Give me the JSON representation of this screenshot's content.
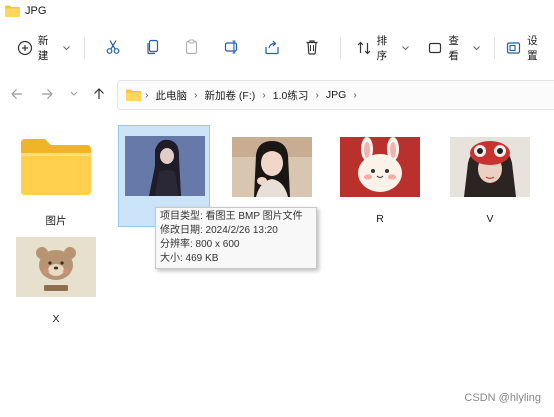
{
  "window": {
    "title": "JPG"
  },
  "toolbar": {
    "new_label": "新建",
    "sort_label": "排序",
    "view_label": "查看",
    "settings_label": "设置"
  },
  "address": {
    "segments": [
      "此电脑",
      "新加卷 (F:)",
      "1.0练习",
      "JPG"
    ]
  },
  "items": [
    {
      "label": "图片",
      "type": "folder"
    },
    {
      "label": "",
      "type": "image"
    },
    {
      "label": "",
      "type": "image"
    },
    {
      "label": "R",
      "type": "image"
    },
    {
      "label": "V",
      "type": "image"
    },
    {
      "label": "X",
      "type": "image"
    }
  ],
  "tooltip": {
    "type_line": "项目类型: 看图王 BMP 图片文件",
    "modified_line": "修改日期: 2024/2/26 13:20",
    "resolution_line": "分辨率: 800 x 600",
    "size_line": "大小: 469 KB"
  },
  "watermark": "CSDN @hlyling",
  "colors": {
    "folder": "#f6c343",
    "selection": "#cce4f7",
    "accent": "#0067c0"
  }
}
